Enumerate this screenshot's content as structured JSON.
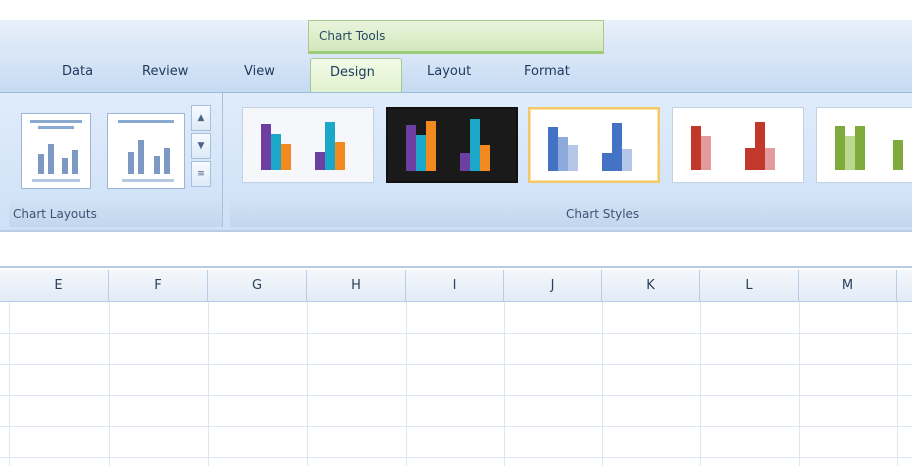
{
  "contextual_tab_group": {
    "label": "Chart Tools"
  },
  "tabs": [
    {
      "label": "Data"
    },
    {
      "label": "Review"
    },
    {
      "label": "View"
    },
    {
      "label": "Design"
    },
    {
      "label": "Layout"
    },
    {
      "label": "Format"
    }
  ],
  "ribbon": {
    "group_layouts": {
      "label": "Chart Layouts"
    },
    "group_styles": {
      "label": "Chart Styles"
    }
  },
  "columns": [
    "E",
    "F",
    "G",
    "H",
    "I",
    "J",
    "K",
    "L",
    "M"
  ],
  "colors": {
    "style1": [
      "#6d3fa0",
      "#1aa7c8",
      "#f28a20"
    ],
    "style2": [
      "#6d3fa0",
      "#1aa7c8",
      "#f28a20"
    ],
    "style3": [
      "#4472c4",
      "#8eaadb",
      "#b4c7e7"
    ],
    "style4": [
      "#c0392b",
      "#e39a9a",
      "#c0392b"
    ],
    "style5": [
      "#7faa3c",
      "#bcd88e",
      "#7faa3c"
    ]
  }
}
